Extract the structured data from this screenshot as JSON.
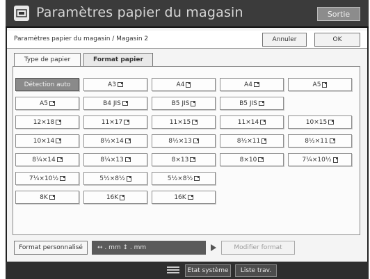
{
  "header": {
    "title": "Paramètres papier du magasin",
    "exit_label": "Sortie"
  },
  "subheader": {
    "breadcrumb": "Paramètres papier du magasin / Magasin 2",
    "cancel_label": "Annuler",
    "ok_label": "OK"
  },
  "tabs": [
    {
      "label": "Type de papier",
      "active": false
    },
    {
      "label": "Format papier",
      "active": true
    }
  ],
  "sizes": [
    {
      "label": "Détection auto",
      "orientation": "none",
      "selected": true
    },
    {
      "label": "A3",
      "orientation": "landscape"
    },
    {
      "label": "A4",
      "orientation": "portrait"
    },
    {
      "label": "A4",
      "orientation": "landscape"
    },
    {
      "label": "A5",
      "orientation": "portrait"
    },
    {
      "label": "A5",
      "orientation": "landscape"
    },
    {
      "label": "B4 JIS",
      "orientation": "landscape"
    },
    {
      "label": "B5 JIS",
      "orientation": "portrait"
    },
    {
      "label": "B5 JIS",
      "orientation": "landscape"
    },
    {
      "label": "12×18",
      "orientation": "landscape"
    },
    {
      "label": "11×17",
      "orientation": "landscape"
    },
    {
      "label": "11×15",
      "orientation": "landscape"
    },
    {
      "label": "11×14",
      "orientation": "landscape"
    },
    {
      "label": "10×15",
      "orientation": "landscape"
    },
    {
      "label": "10×14",
      "orientation": "landscape"
    },
    {
      "label": "8½×14",
      "orientation": "landscape"
    },
    {
      "label": "8½×13",
      "orientation": "landscape"
    },
    {
      "label": "8½×11",
      "orientation": "portrait"
    },
    {
      "label": "8½×11",
      "orientation": "landscape"
    },
    {
      "label": "8¼×14",
      "orientation": "landscape"
    },
    {
      "label": "8¼×13",
      "orientation": "landscape"
    },
    {
      "label": "8×13",
      "orientation": "landscape"
    },
    {
      "label": "8×10",
      "orientation": "landscape"
    },
    {
      "label": "7¼×10½",
      "orientation": "portrait"
    },
    {
      "label": "7¼×10½",
      "orientation": "landscape"
    },
    {
      "label": "5½×8½",
      "orientation": "portrait"
    },
    {
      "label": "5½×8½",
      "orientation": "landscape"
    },
    {
      "label": "8K",
      "orientation": "landscape"
    },
    {
      "label": "16K",
      "orientation": "portrait"
    },
    {
      "label": "16K",
      "orientation": "landscape"
    }
  ],
  "custom": {
    "custom_label": "Format personnalisé",
    "dim_text": "↔  .  mm  ↕  .  mm",
    "modify_label": "Modifier format"
  },
  "status": {
    "job_status_label": "Etat système",
    "job_list_label": "Liste trav."
  },
  "colors": {
    "titlebar": "#3b3b3b",
    "selected": "#8a8a8a",
    "statusbar": "#2e2e2e"
  }
}
